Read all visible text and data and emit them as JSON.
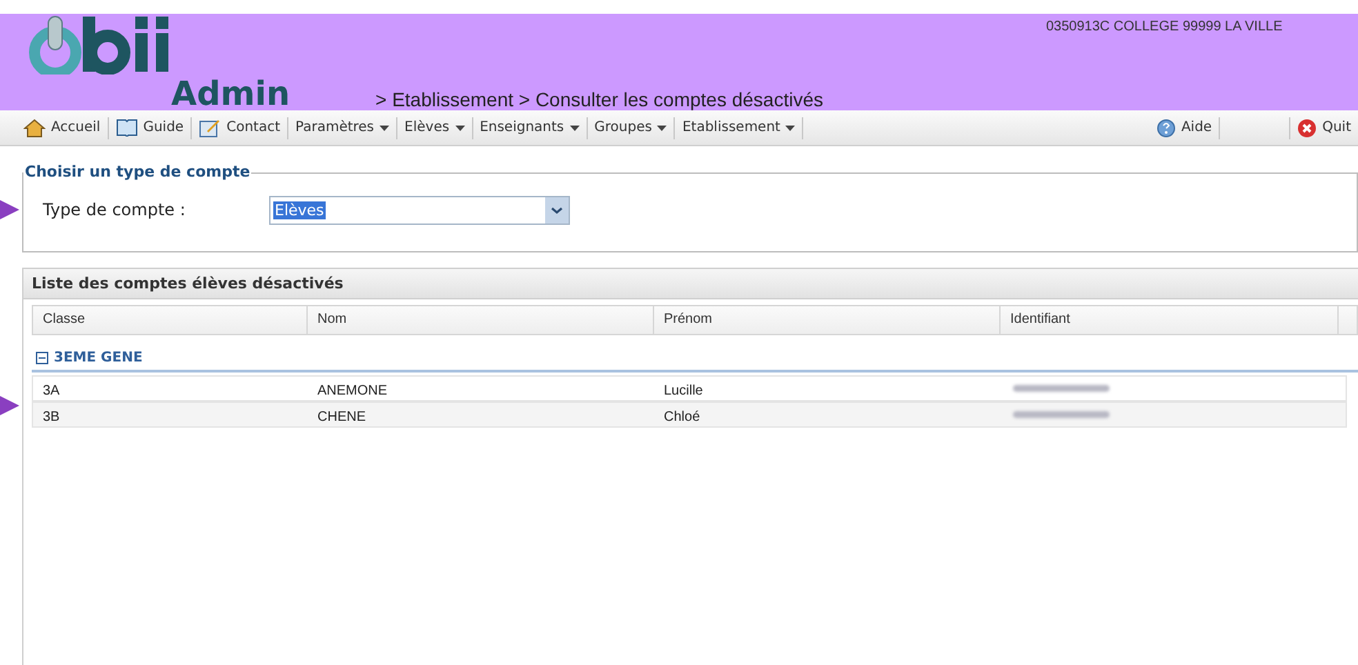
{
  "header": {
    "app": "Admin",
    "breadcrumb": "> Etablissement > Consulter les comptes désactivés",
    "school": "0350913C COLLEGE 99999 LA VILLE"
  },
  "toolbar": {
    "left": [
      {
        "label": "Accueil",
        "kind": "home"
      },
      {
        "label": "Guide",
        "kind": "book"
      },
      {
        "label": "Contact",
        "kind": "note"
      },
      {
        "label": "Paramètres",
        "kind": "menu"
      },
      {
        "label": "Elèves",
        "kind": "menu"
      },
      {
        "label": "Enseignants",
        "kind": "menu"
      },
      {
        "label": "Groupes",
        "kind": "menu"
      },
      {
        "label": "Etablissement",
        "kind": "menu"
      }
    ],
    "right": [
      {
        "label": "Aide",
        "kind": "help"
      },
      {
        "label": "Quit",
        "kind": "quit"
      }
    ]
  },
  "account_type": {
    "legend": "Choisir un type de compte",
    "label": "Type de compte :",
    "value": "Elèves"
  },
  "list": {
    "title": "Liste des comptes élèves désactivés",
    "columns": [
      "Classe",
      "Nom",
      "Prénom",
      "Identifiant"
    ],
    "group": {
      "label": "3EME GENE",
      "expanded": true
    },
    "rows": [
      {
        "classe": "3A",
        "nom": "ANEMONE",
        "prenom": "Lucille"
      },
      {
        "classe": "3B",
        "nom": "CHENE",
        "prenom": "Chloé"
      }
    ]
  }
}
